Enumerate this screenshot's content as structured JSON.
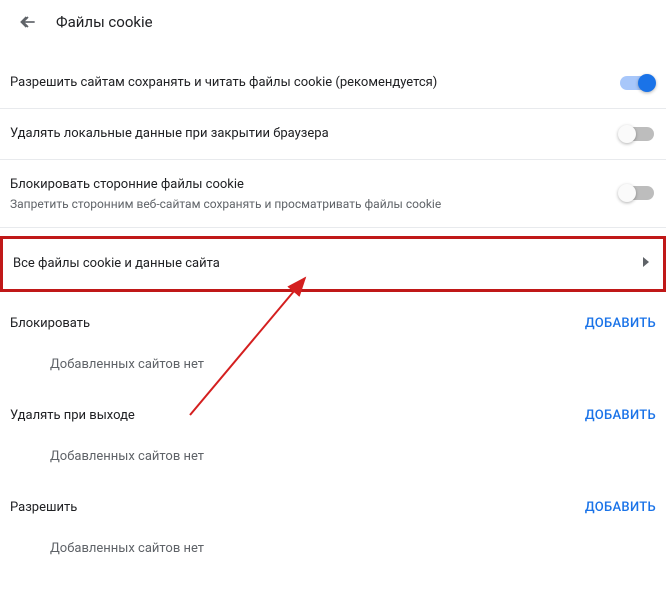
{
  "header": {
    "title": "Файлы cookie"
  },
  "settings": {
    "allowSites": {
      "label": "Разрешить сайтам сохранять и читать файлы cookie (рекомендуется)",
      "enabled": true
    },
    "deleteOnClose": {
      "label": "Удалять локальные данные при закрытии браузера",
      "enabled": false
    },
    "blockThirdParty": {
      "label": "Блокировать сторонние файлы cookie",
      "sublabel": "Запретить сторонним веб-сайтам сохранять и просматривать файлы cookie",
      "enabled": false
    },
    "allCookies": {
      "label": "Все файлы cookie и данные сайта"
    }
  },
  "sections": {
    "block": {
      "title": "Блокировать",
      "addLabel": "ДОБАВИТЬ",
      "emptyMsg": "Добавленных сайтов нет"
    },
    "deleteOnExit": {
      "title": "Удалять при выходе",
      "addLabel": "ДОБАВИТЬ",
      "emptyMsg": "Добавленных сайтов нет"
    },
    "allow": {
      "title": "Разрешить",
      "addLabel": "ДОБАВИТЬ",
      "emptyMsg": "Добавленных сайтов нет"
    }
  }
}
